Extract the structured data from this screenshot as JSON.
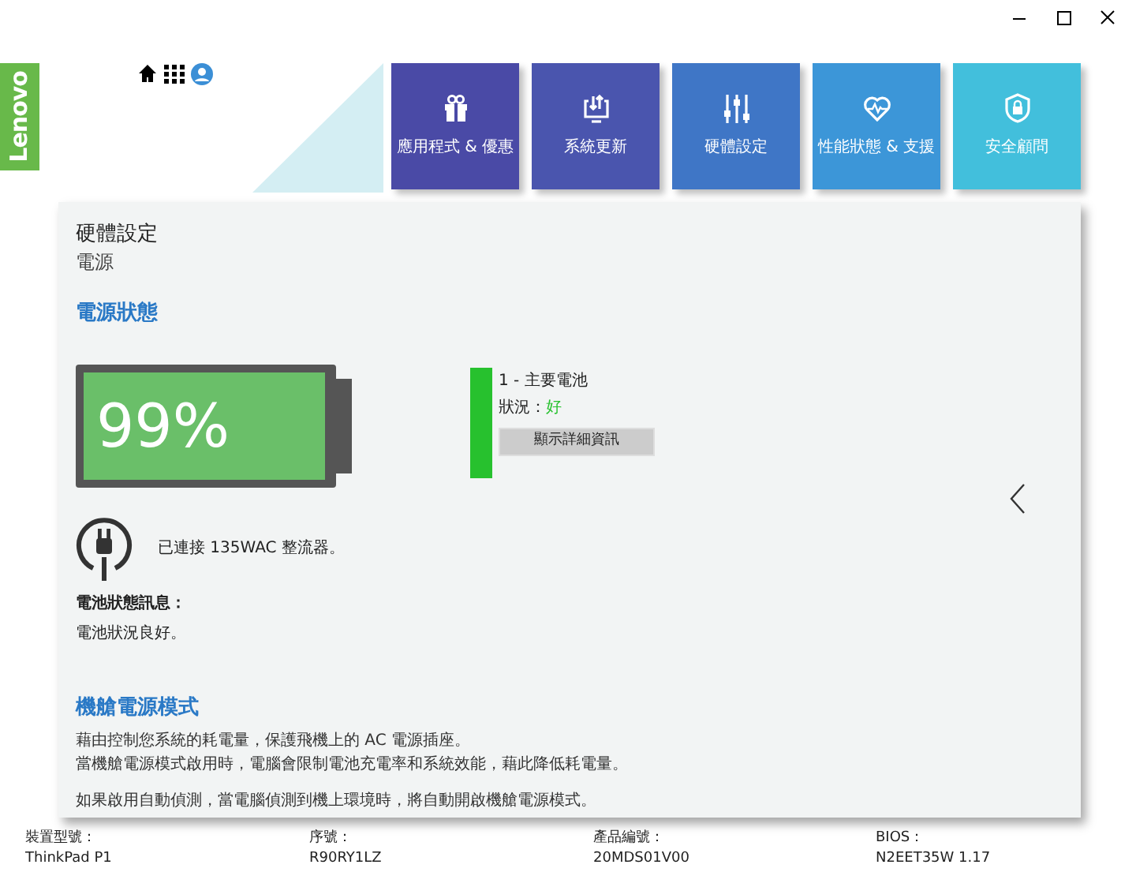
{
  "brand": {
    "logo": "Lenovo"
  },
  "tiles": [
    {
      "label": "應用程式 & 優惠"
    },
    {
      "label": "系統更新"
    },
    {
      "label": "硬體設定"
    },
    {
      "label": "性能狀態 & 支援"
    },
    {
      "label": "安全顧問"
    }
  ],
  "page": {
    "title": "硬體設定",
    "subtitle": "電源"
  },
  "power_status": {
    "heading": "電源狀態",
    "battery": {
      "percent": "99%",
      "level": 0.99
    },
    "batteries": [
      {
        "name": "1 - 主要電池",
        "status_label": "狀況：",
        "status": "好",
        "healthy": true,
        "button": "顯示詳細資訊"
      }
    ],
    "adapter": "已連接 135WAC 整流器。",
    "message_heading": "電池狀態訊息：",
    "message": "電池狀況良好。"
  },
  "airplane_mode": {
    "heading": "機艙電源模式",
    "paragraphs": [
      "藉由控制您系統的耗電量，保護飛機上的 AC 電源插座。",
      "當機艙電源模式啟用時，電腦會限制電池充電率和系統效能，藉此降低耗電量。",
      "如果啟用自動偵測，當電腦偵測到機上環境時，將自動開啟機艙電源模式。"
    ]
  },
  "footer": [
    {
      "label": "裝置型號：",
      "value": "ThinkPad P1"
    },
    {
      "label": "序號：",
      "value": "R90RY1LZ"
    },
    {
      "label": "產品編號：",
      "value": "20MDS01V00"
    },
    {
      "label": "BIOS：",
      "value": "N2EET35W 1.17"
    }
  ]
}
